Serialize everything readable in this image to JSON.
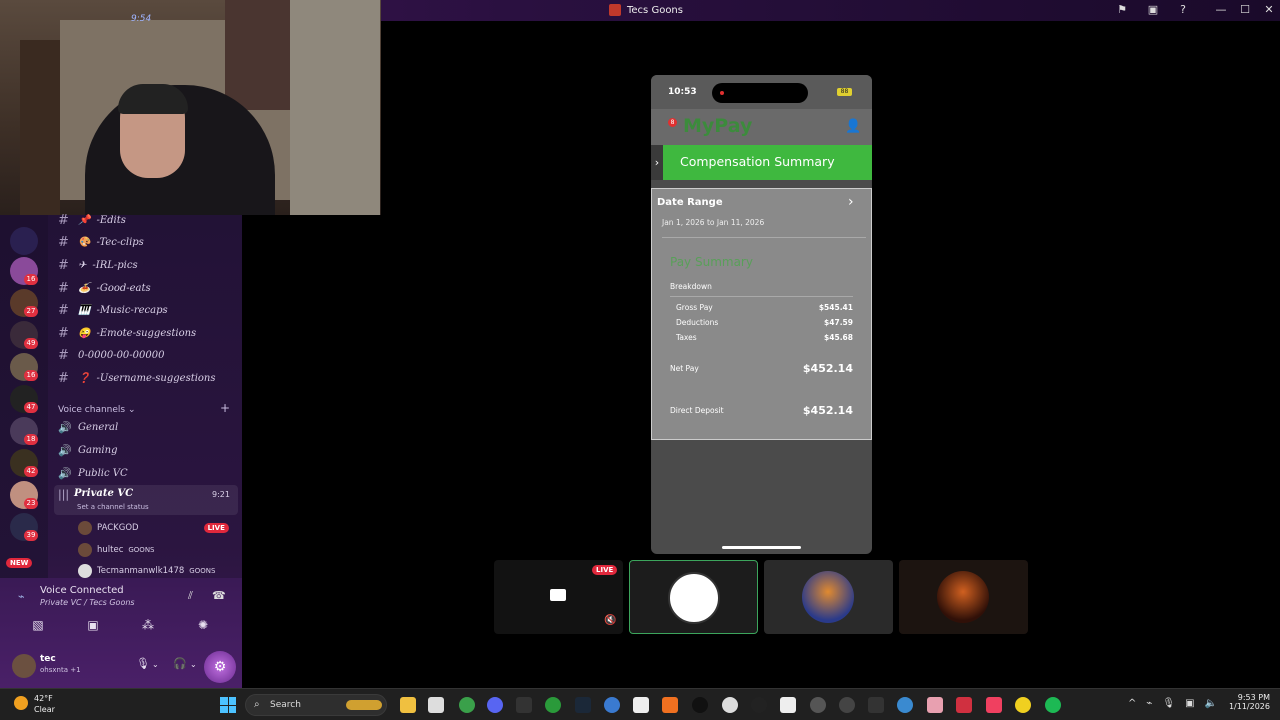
{
  "window": {
    "title": "Tecs Goons"
  },
  "webcam": {
    "overlay_text": "9:54"
  },
  "channels": [
    {
      "emoji": "📌",
      "name": "-Edits"
    },
    {
      "emoji": "🎨",
      "name": "-Tec-clips"
    },
    {
      "emoji": "✈",
      "name": "-IRL-pics"
    },
    {
      "emoji": "🍝",
      "name": "-Good-eats"
    },
    {
      "emoji": "🎹",
      "name": "-Music-recaps"
    },
    {
      "emoji": "😜",
      "name": "-Emote-suggestions"
    },
    {
      "emoji": "",
      "name": "0-0000-00-00000"
    },
    {
      "emoji": "❓",
      "name": "-Username-suggestions"
    }
  ],
  "voice": {
    "header": "Voice channels",
    "channels": [
      {
        "name": "General"
      },
      {
        "name": "Gaming"
      },
      {
        "name": "Public VC"
      },
      {
        "name": "Private VC",
        "time": "9:21",
        "status": "Set a channel status"
      }
    ],
    "members": [
      {
        "name": "PACKGOD",
        "badge": "LIVE"
      },
      {
        "name": "hultec",
        "tag": "GOONS"
      },
      {
        "name": "Tecmanmanwlk1478",
        "tag": "GOONS"
      }
    ]
  },
  "servers": [
    {
      "badge": ""
    },
    {
      "badge": "16"
    },
    {
      "badge": "27"
    },
    {
      "badge": "49"
    },
    {
      "badge": "16"
    },
    {
      "badge": "47"
    },
    {
      "badge": "18"
    },
    {
      "badge": "42"
    },
    {
      "badge": "23"
    },
    {
      "badge": "39"
    }
  ],
  "server_new_label": "NEW",
  "voice_panel": {
    "status": "Voice Connected",
    "sub": "Private VC / Tecs Goons"
  },
  "user": {
    "name": "tec",
    "status": "ohsxnta +1"
  },
  "phone": {
    "time": "10:53",
    "battery": "88",
    "app_name": "MyPay",
    "notification_count": "8",
    "section_title": "Compensation Summary",
    "date_range_label": "Date Range",
    "date_range_value": "Jan 1, 2026 to Jan 11, 2026",
    "pay_summary_title": "Pay Summary",
    "breakdown_label": "Breakdown",
    "rows": [
      {
        "label": "Gross Pay",
        "value": "$545.41"
      },
      {
        "label": "Deductions",
        "value": "$47.59"
      },
      {
        "label": "Taxes",
        "value": "$45.68"
      }
    ],
    "net_pay_label": "Net Pay",
    "net_pay_value": "$452.14",
    "direct_deposit_label": "Direct Deposit",
    "direct_deposit_value": "$452.14"
  },
  "tiles": {
    "live_label": "LIVE"
  },
  "taskbar": {
    "weather_temp": "42°F",
    "weather_desc": "Clear",
    "search_placeholder": "Search",
    "time": "9:53 PM",
    "date": "1/11/2026"
  },
  "colors": {
    "accent_green": "#3fb83f",
    "live_red": "#e0283c",
    "discord_purple": "#2b1540"
  }
}
